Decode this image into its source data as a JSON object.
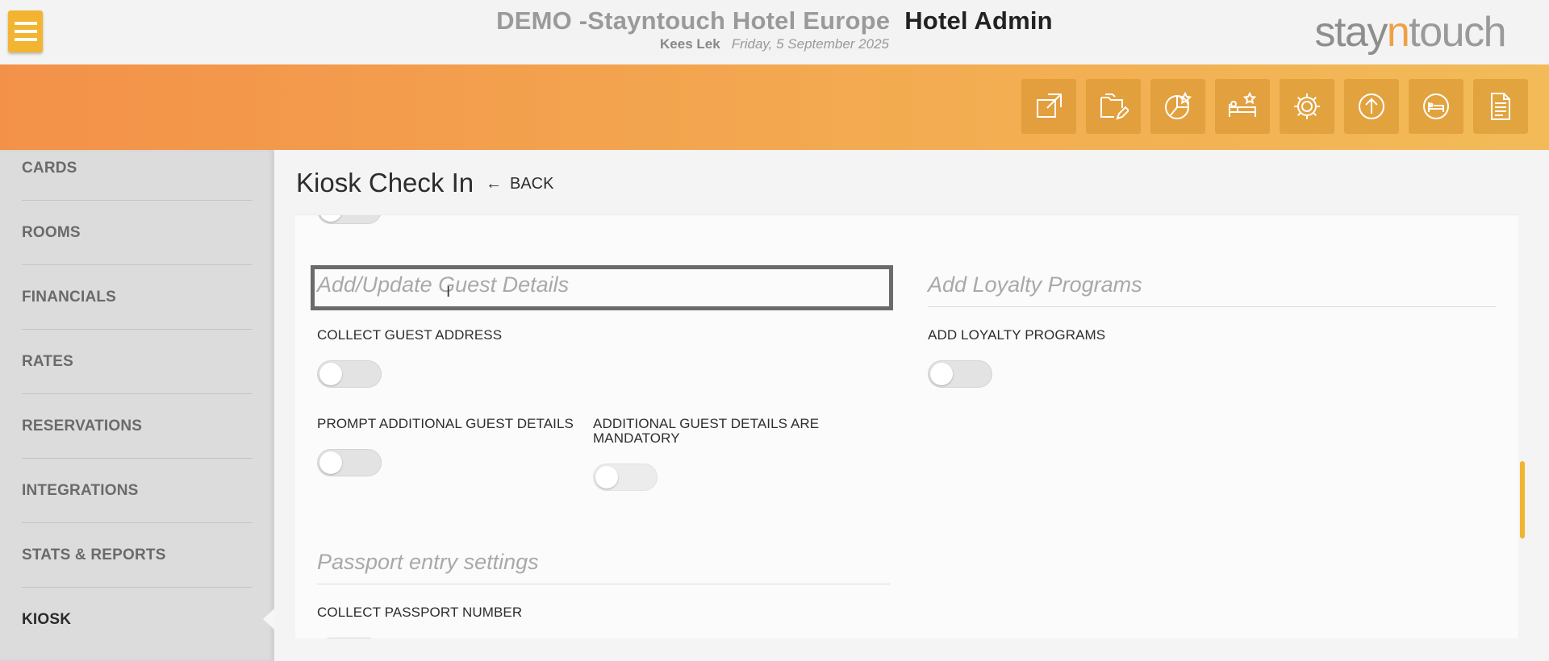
{
  "header": {
    "hotel_name": "DEMO -Stayntouch Hotel Europe",
    "app_name": "Hotel Admin",
    "user": "Kees Lek",
    "date": "Friday, 5 September 2025",
    "brand": {
      "part1": "stay",
      "part2": "n",
      "part3": "touch"
    },
    "menu_icon": "hamburger-icon"
  },
  "toolbar": {
    "icons": [
      "external-link-icon",
      "folder-edit-icon",
      "chart-star-icon",
      "bed-star-icon",
      "gear-icon",
      "upload-icon",
      "bed-icon",
      "document-icon"
    ]
  },
  "sidebar": {
    "items": [
      {
        "label": "CARDS"
      },
      {
        "label": "ROOMS"
      },
      {
        "label": "FINANCIALS"
      },
      {
        "label": "RATES"
      },
      {
        "label": "RESERVATIONS"
      },
      {
        "label": "INTEGRATIONS"
      },
      {
        "label": "STATS & REPORTS"
      },
      {
        "label": "KIOSK"
      }
    ],
    "active": "KIOSK"
  },
  "page": {
    "title": "Kiosk Check In",
    "back_label": "BACK",
    "back_icon": "arrow-left-icon"
  },
  "sections": {
    "guest_details": {
      "title": "Add/Update Guest Details",
      "collect_address_label": "COLLECT GUEST ADDRESS",
      "collect_address_on": false,
      "prompt_additional_label": "PROMPT ADDITIONAL GUEST DETAILS",
      "prompt_additional_on": false,
      "additional_mandatory_label": "ADDITIONAL GUEST DETAILS ARE MANDATORY",
      "additional_mandatory_on": false
    },
    "loyalty": {
      "title": "Add Loyalty Programs",
      "add_loyalty_label": "ADD LOYALTY PROGRAMS",
      "add_loyalty_on": false
    },
    "passport": {
      "title": "Passport entry settings",
      "collect_passport_label": "COLLECT PASSPORT NUMBER"
    }
  },
  "colors": {
    "accent": "#f2b431",
    "banner_start": "#f39149",
    "banner_end": "#f2bb58",
    "brand_orange": "#f0a044"
  }
}
